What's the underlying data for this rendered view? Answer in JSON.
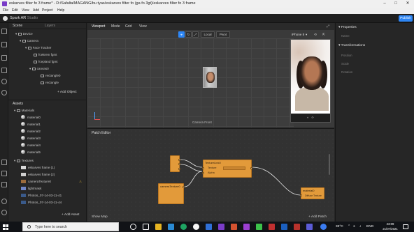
{
  "window": {
    "title": "eskarves filter fo 3 frame* - D:/Safalta/MAGANG/bu tyas/eskarves filter fo (ga fo 3gt)/eskarves filter fo 3 frame",
    "min": "–",
    "max": "□",
    "close": "✕"
  },
  "menu": [
    "File",
    "Edit",
    "View",
    "Add",
    "Project",
    "Help"
  ],
  "app": {
    "brand": "Spark AR",
    "brand_sub": "Studio",
    "publish": "Publish"
  },
  "scene": {
    "tabs": [
      "Scene",
      "Layers"
    ],
    "tree": [
      "Device",
      "Camera",
      "Face Tracker",
      "fcekrem fgmt",
      "fcepland fgmt",
      "canvas0",
      "rectangle0",
      "rectangle"
    ],
    "add_object": "+ Add Object"
  },
  "assets": {
    "title": "Assets",
    "materials_label": "Materials",
    "materials": [
      "material0",
      "material1",
      "material2",
      "material3",
      "material4",
      "material5"
    ],
    "textures_label": "Textures",
    "textures": [
      "eskarves frame (1)",
      "eskarves frame (2)",
      "cameraTexture0",
      "lightmask",
      "Photos_07-14-03-11-41",
      "Photos_07-14-03-11-44"
    ],
    "add_asset": "+ Add Asset"
  },
  "viewport": {
    "tabs": [
      "Viewport",
      "Mode",
      "Grid",
      "View"
    ],
    "tools": [
      "⌖",
      "↻",
      "⤢",
      "Local",
      "Pivot"
    ],
    "camera_label": "Camera Front",
    "device": "iPhone 8"
  },
  "patch": {
    "title": "Patch Editor",
    "nodes": {
      "left_small": "",
      "texture": "TextureLink0",
      "texture_port1": "Texture",
      "texture_port2": "Alpha",
      "camera": "cameraTexture0",
      "output": "material0",
      "output_port": "Diffuse Texture"
    },
    "show_map": "Show Map",
    "add_patch": "+ Add Patch"
  },
  "properties": {
    "title": "Properties",
    "name_label": "Name",
    "transformations": "Transformations",
    "position": "Position",
    "scale": "Scale",
    "rotation": "Rotation"
  },
  "taskbar": {
    "search_placeholder": "Type here to search",
    "weather": "33°C",
    "lang": "ENG",
    "time": "23:09",
    "date": "21/07/2021"
  },
  "colors": {
    "accent": "#2d86f5",
    "node": "#e29a3a"
  }
}
